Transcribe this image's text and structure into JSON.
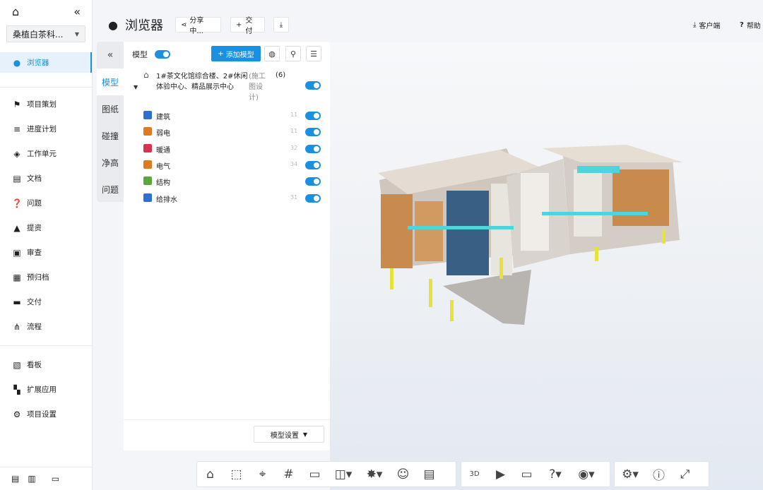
{
  "sidebar": {
    "project": "桑植白茶科...",
    "active_item": "浏览器",
    "groups": [
      [
        "项目策划",
        "进度计划",
        "工作单元",
        "文档",
        "问题",
        "提资",
        "审查",
        "预归档",
        "交付",
        "流程"
      ],
      [
        "看板",
        "扩展应用",
        "项目设置"
      ]
    ]
  },
  "header": {
    "title": "浏览器",
    "share": "分享中...",
    "deliver": "交付",
    "client": "客户端",
    "help": "帮助"
  },
  "vtabs": [
    "模型",
    "图纸",
    "碰撞",
    "净高",
    "问题"
  ],
  "panel": {
    "label": "模型",
    "add_model": "添加模型",
    "root": {
      "name": "1#茶文化馆综合楼、2#休闲体验中心、精品展示中心",
      "stage": "(施工图设计)",
      "count": "(6)"
    },
    "layers": [
      {
        "name": "建筑",
        "num": "11",
        "color": "#2f6fd0"
      },
      {
        "name": "弱电",
        "num": "11",
        "color": "#e07a1f"
      },
      {
        "name": "暖通",
        "num": "32",
        "color": "#d8344f"
      },
      {
        "name": "电气",
        "num": "34",
        "color": "#e07a1f"
      },
      {
        "name": "结构",
        "num": "",
        "color": "#5aa63a"
      },
      {
        "name": "给排水",
        "num": "31",
        "color": "#2f6fd0"
      }
    ],
    "settings": "模型设置"
  },
  "colors": {
    "accent": "#1b8fe0"
  }
}
